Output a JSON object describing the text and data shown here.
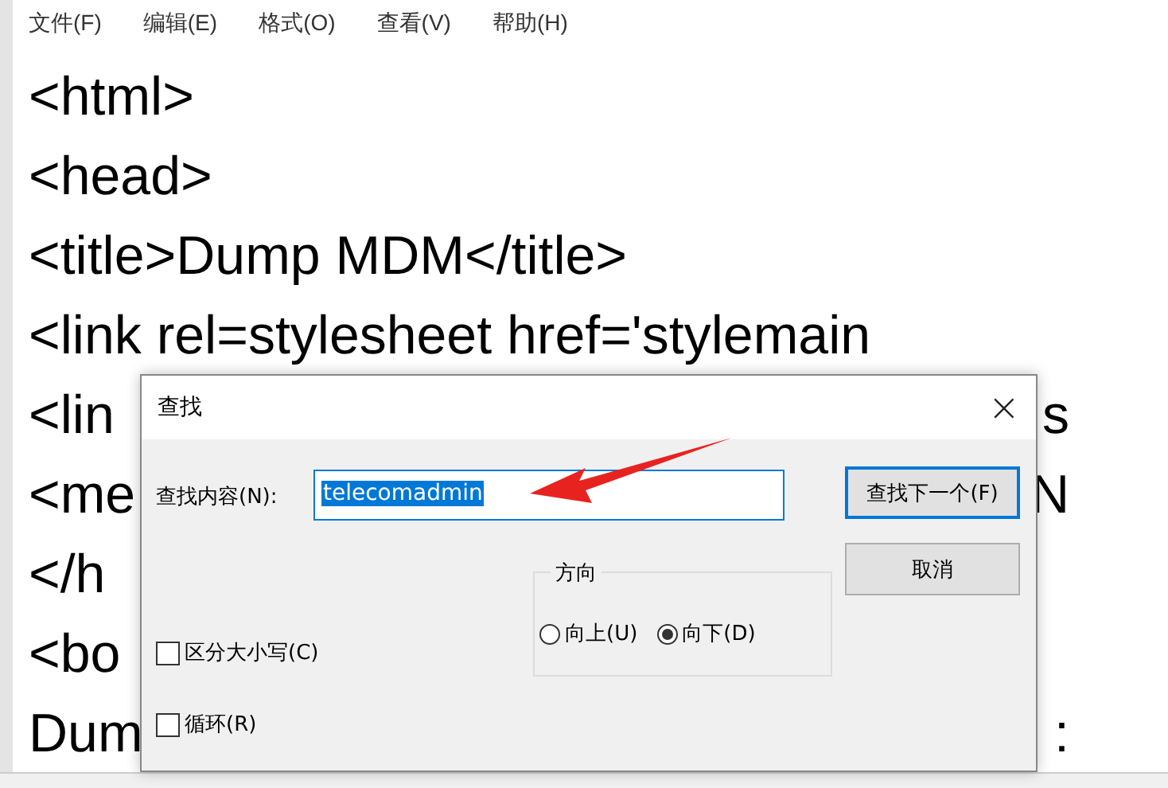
{
  "menu": [
    "文件(F)",
    "编辑(E)",
    "格式(O)",
    "查看(V)",
    "帮助(H)"
  ],
  "editor_lines": [
    {
      "left": "<html>"
    },
    {
      "left": "<head>"
    },
    {
      "left": "<title>Dump MDM</title>"
    },
    {
      "left": "<link rel=stylesheet href='stylemain"
    },
    {
      "left": "<lin",
      "right": "s"
    },
    {
      "left": "<me",
      "right": "N"
    },
    {
      "left": "</h"
    },
    {
      "left": "<bo"
    },
    {
      "left": "Dum",
      "right": ":"
    }
  ],
  "dialog": {
    "title": "查找",
    "close": "×",
    "find_label": "查找内容(N):",
    "find_value": "telecomadmin",
    "buttons": [
      {
        "label": "查找下一个(F)",
        "default": true
      },
      {
        "label": "取消",
        "default": false
      }
    ],
    "direction": {
      "title": "方向",
      "options": [
        {
          "label": "向上(U)",
          "selected": false
        },
        {
          "label": "向下(D)",
          "selected": true
        }
      ]
    },
    "checkboxes": [
      {
        "label": "区分大小写(C)",
        "checked": false
      },
      {
        "label": "循环(R)",
        "checked": false
      }
    ]
  }
}
